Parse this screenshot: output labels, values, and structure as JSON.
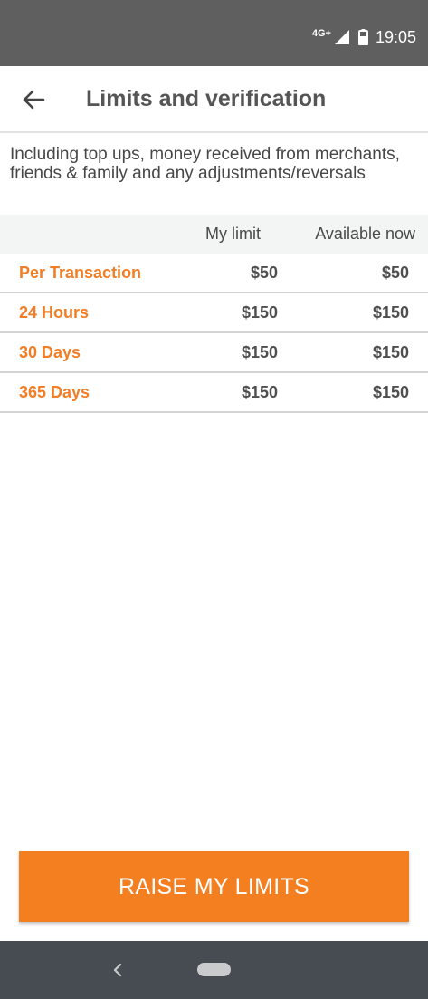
{
  "status_bar": {
    "network": "4G+",
    "time": "19:05"
  },
  "header": {
    "title": "Limits and verification"
  },
  "description": "Including top ups, money received from merchants, friends & family and any adjustments/reversals",
  "table": {
    "columns": [
      "My limit",
      "Available now"
    ],
    "rows": [
      {
        "period": "Per Transaction",
        "my_limit": "$50",
        "available": "$50"
      },
      {
        "period": "24 Hours",
        "my_limit": "$150",
        "available": "$150"
      },
      {
        "period": "30 Days",
        "my_limit": "$150",
        "available": "$150"
      },
      {
        "period": "365 Days",
        "my_limit": "$150",
        "available": "$150"
      }
    ]
  },
  "action": {
    "raise_label": "RAISE MY LIMITS"
  },
  "colors": {
    "accent": "#f47f20",
    "status_bar": "#5f5f5f",
    "nav_bar": "#474c52"
  },
  "icons": {
    "back": "arrow-left-icon",
    "nav_back": "chevron-left-icon",
    "nav_home": "home-pill-icon"
  }
}
